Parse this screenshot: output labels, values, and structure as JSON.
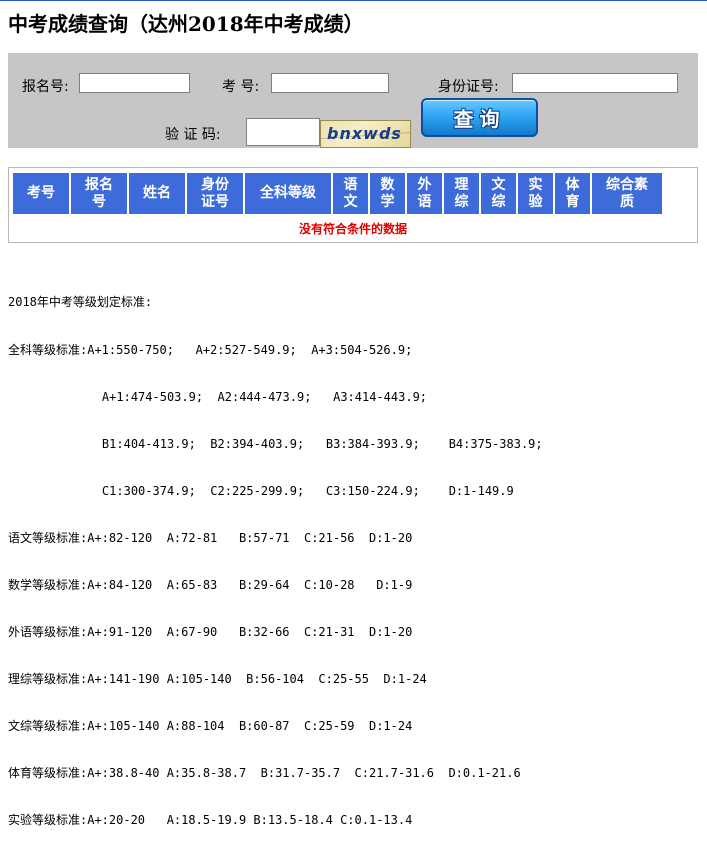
{
  "page": {
    "title": "中考成绩查询（达州2018年中考成绩）"
  },
  "form": {
    "exam_number_label": "报名号:",
    "exam_number_value": "",
    "candidate_number_label": "考 号:",
    "candidate_number_value": "",
    "id_number_label": "身份证号:",
    "id_number_value": "",
    "captcha_label": "验 证 码:",
    "captcha_value": "",
    "captcha_image_text": "bnxwds",
    "query_button_label": "查询"
  },
  "results_table": {
    "headers": [
      "考号",
      "报名号",
      "姓名",
      "身份证号",
      "全科等级",
      "语文",
      "数学",
      "外语",
      "理综",
      "文综",
      "实验",
      "体育",
      "综合素质"
    ],
    "empty_message": "没有符合条件的数据"
  },
  "standards": {
    "heading": "2018年中考等级划定标准:",
    "lines": [
      "全科等级标准:A+1:550-750;   A+2:527-549.9;  A+3:504-526.9;",
      "             A+1:474-503.9;  A2:444-473.9;   A3:414-443.9;",
      "             B1:404-413.9;  B2:394-403.9;   B3:384-393.9;    B4:375-383.9;",
      "             C1:300-374.9;  C2:225-299.9;   C3:150-224.9;    D:1-149.9",
      "语文等级标准:A+:82-120  A:72-81   B:57-71  C:21-56  D:1-20",
      "数学等级标准:A+:84-120  A:65-83   B:29-64  C:10-28   D:1-9",
      "外语等级标准:A+:91-120  A:67-90   B:32-66  C:21-31  D:1-20",
      "理综等级标准:A+:141-190 A:105-140  B:56-104  C:25-55  D:1-24",
      "文综等级标准:A+:105-140 A:88-104  B:60-87  C:25-59  D:1-24",
      "体育等级标准:A+:38.8-40 A:35.8-38.7  B:31.7-35.7  C:21.7-31.6  D:0.1-21.6",
      "实验等级标准:A+:20-20   A:18.5-19.9 B:13.5-18.4 C:0.1-13.4"
    ]
  },
  "colors": {
    "accent_blue": "#3d6bd9",
    "panel_gray": "#c6c6c6",
    "error_red": "#e00000",
    "button_blue": "#2fa6f4"
  }
}
